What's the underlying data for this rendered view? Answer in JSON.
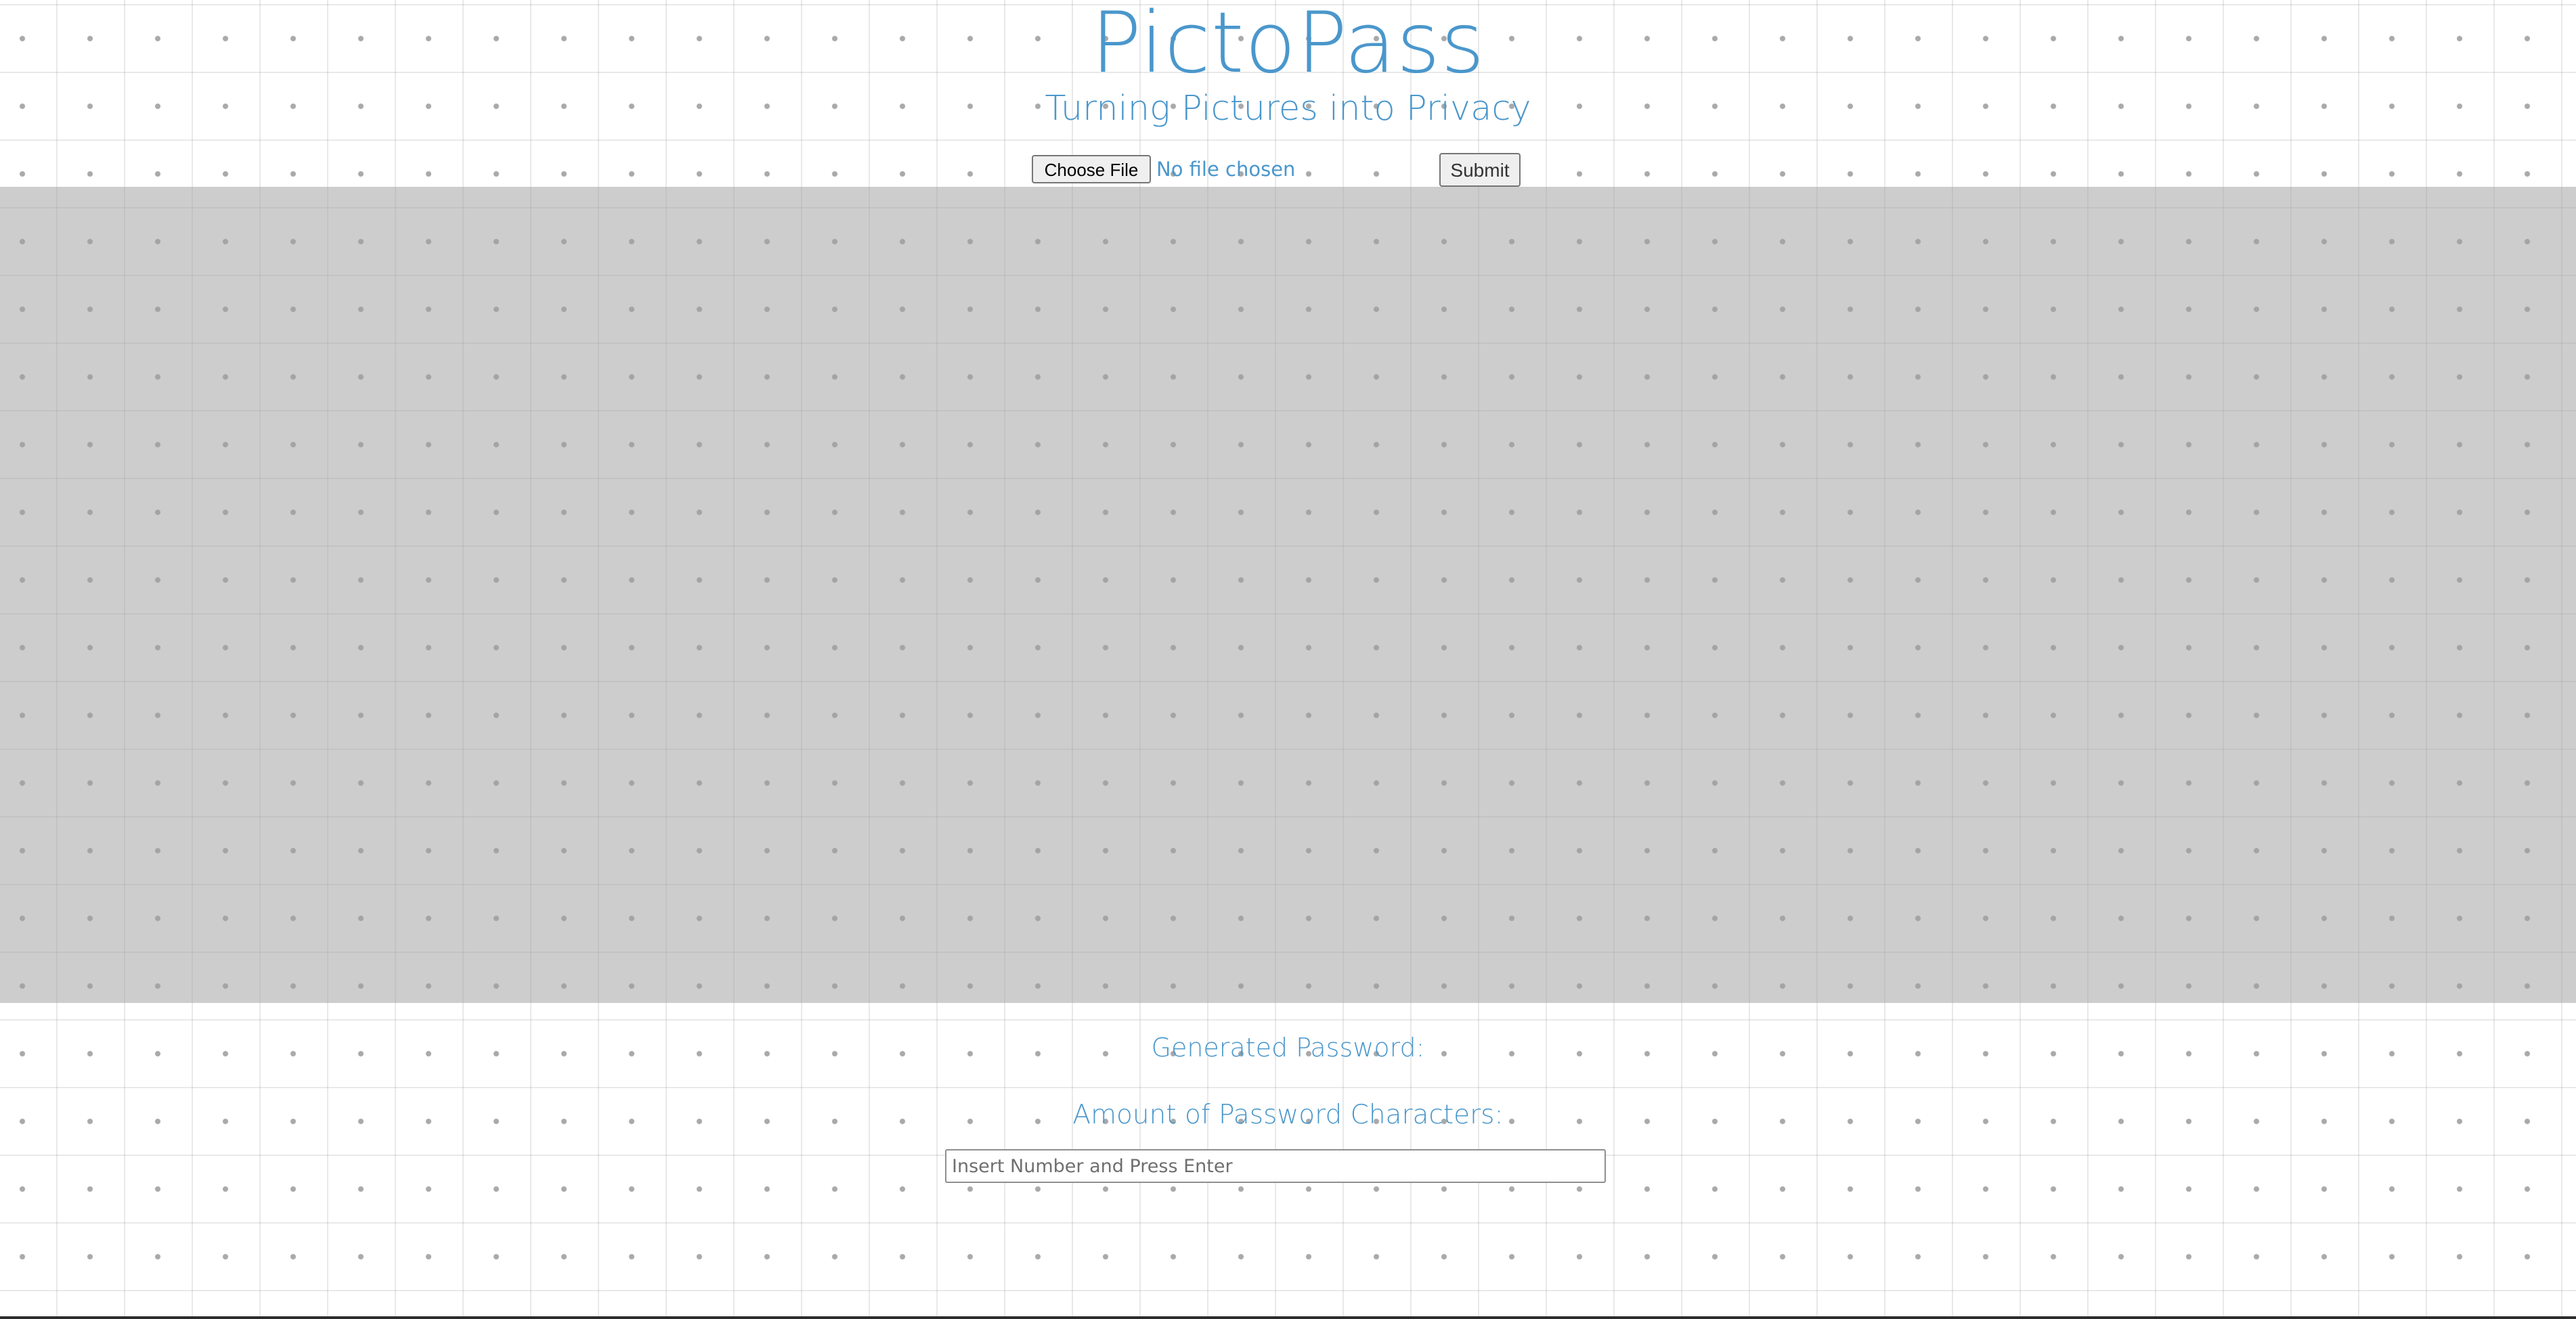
{
  "header": {
    "title": "PictoPass",
    "subtitle": "Turning Pictures into Privacy"
  },
  "upload": {
    "choose_file_label": "Choose File",
    "file_status": "No file chosen",
    "submit_label": "Submit"
  },
  "password": {
    "generated_label": "Generated Password:",
    "amount_label": "Amount of Password Characters:",
    "input_value": "",
    "input_placeholder": "Insert Number and Press Enter"
  },
  "colors": {
    "accent": "#4a97cc",
    "panel": "#cacaca",
    "background": "#ffffff"
  }
}
